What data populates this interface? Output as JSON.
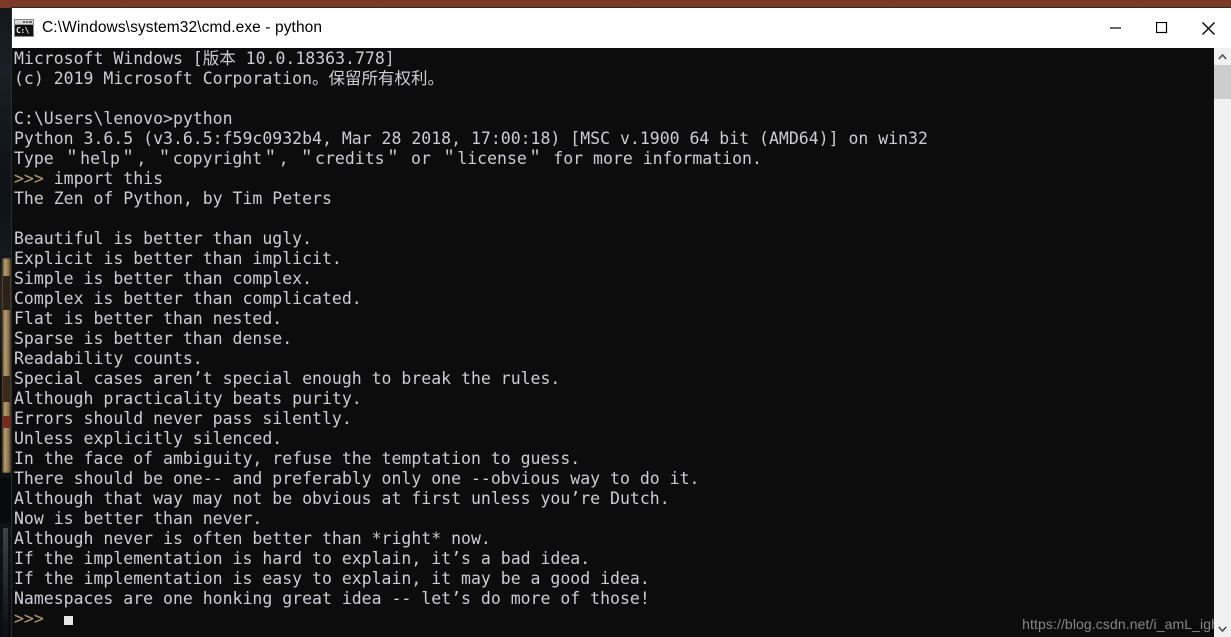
{
  "window": {
    "title": "C:\\Windows\\system32\\cmd.exe - python",
    "icon": "cmd-console-icon",
    "icon_glyph": "C:\\",
    "controls": {
      "minimize": "minimize-button",
      "maximize": "maximize-button",
      "close": "close-button"
    }
  },
  "console": {
    "lines": [
      "Microsoft Windows [版本 10.0.18363.778]",
      "(c) 2019 Microsoft Corporation。保留所有权利。",
      "",
      "C:\\Users\\lenovo>python",
      "Python 3.6.5 (v3.6.5:f59c0932b4, Mar 28 2018, 17:00:18) [MSC v.1900 64 bit (AMD64)] on win32",
      "Type ＂help＂, ＂copyright＂, ＂credits＂ or ＂license＂ for more information.",
      "PROMPT:import this",
      "The Zen of Python, by Tim Peters",
      "",
      "Beautiful is better than ugly.",
      "Explicit is better than implicit.",
      "Simple is better than complex.",
      "Complex is better than complicated.",
      "Flat is better than nested.",
      "Sparse is better than dense.",
      "Readability counts.",
      "Special cases aren’t special enough to break the rules.",
      "Although practicality beats purity.",
      "Errors should never pass silently.",
      "Unless explicitly silenced.",
      "In the face of ambiguity, refuse the temptation to guess.",
      "There should be one-- and preferably only one --obvious way to do it.",
      "Although that way may not be obvious at first unless you’re Dutch.",
      "Now is better than never.",
      "Although never is often better than *right* now.",
      "If the implementation is hard to explain, it’s a bad idea.",
      "If the implementation is easy to explain, it may be a good idea.",
      "Namespaces are one honking great idea -- let’s do more of those!",
      "PROMPT:CURSOR"
    ],
    "prompt_symbol": ">>>",
    "cursor": "block-cursor",
    "foreground_color": "#ccccd4",
    "background_color": "#0c0c0c",
    "prompt_color": "#b9a074"
  },
  "watermark": {
    "text": "https://blog.csdn.net/i_amL_ight"
  },
  "scrollbar": {
    "up_arrow": "scroll-up-arrow",
    "down_arrow": "scroll-down-arrow",
    "thumb": "scroll-thumb"
  }
}
